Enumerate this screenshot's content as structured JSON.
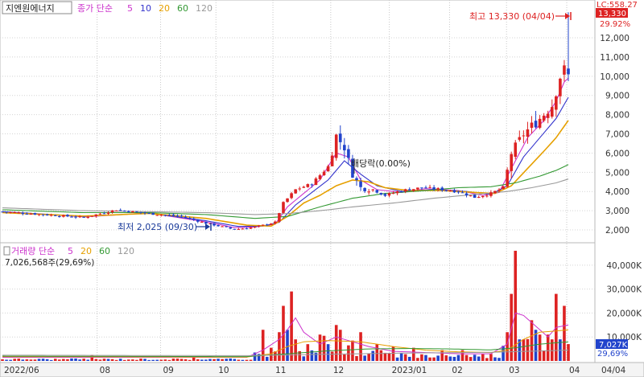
{
  "stock_name": "지엔원에너지",
  "price_legend": {
    "label": "종가 단순",
    "periods": [
      {
        "text": "5",
        "color": "#cc33cc"
      },
      {
        "text": "10",
        "color": "#3333cc"
      },
      {
        "text": "20",
        "color": "#e6a000"
      },
      {
        "text": "60",
        "color": "#339933"
      },
      {
        "text": "120",
        "color": "#999999"
      }
    ]
  },
  "volume_legend": {
    "label": "거래량 단순",
    "periods": [
      {
        "text": "5",
        "color": "#cc33cc"
      },
      {
        "text": "20",
        "color": "#e6a000"
      },
      {
        "text": "60",
        "color": "#339933"
      },
      {
        "text": "120",
        "color": "#999999"
      }
    ],
    "current_text": "7,026,568주(29,69%)"
  },
  "annotations": {
    "high": "최고 13,330 (04/04)",
    "low": "최저 2,025 (09/30)",
    "ex_right": "배당락(0.00%)",
    "top_clipped": "LC:558.27"
  },
  "right_badges": {
    "price": "13,330",
    "price_pct": "29.92%",
    "volume": "7,027K",
    "volume_pct": "29,69%"
  },
  "colors": {
    "up": "#dd2222",
    "down": "#2244cc",
    "ma5": "#cc33cc",
    "ma10": "#3333cc",
    "ma20": "#e6a000",
    "ma60": "#339933",
    "ma120": "#999999",
    "badge_red": "#dd2222",
    "badge_blue": "#2244cc"
  },
  "chart_data": {
    "type": "candlestick",
    "x_ticks": [
      "2022/06",
      "08",
      "09",
      "10",
      "11",
      "12",
      "2023/01",
      "02",
      "03",
      "04",
      "04/04"
    ],
    "price_axis": {
      "ylim": [
        1500,
        13800
      ],
      "ticks": [
        2000,
        3000,
        4000,
        5000,
        6000,
        7000,
        8000,
        9000,
        10000,
        11000,
        12000
      ],
      "tick_labels": [
        "2,000",
        "3,000",
        "4,000",
        "5,000",
        "6,000",
        "7,000",
        "8,000",
        "9,000",
        "10,000",
        "11,000",
        "12,000"
      ]
    },
    "volume_axis": {
      "ylim": [
        0,
        48000
      ],
      "ticks": [
        10000,
        20000,
        30000,
        40000
      ],
      "tick_labels": [
        "10,000K",
        "20,000K",
        "30,000K",
        "40,000K"
      ]
    },
    "price_path": [
      [
        0,
        2950
      ],
      [
        10,
        2800
      ],
      [
        20,
        2650
      ],
      [
        28,
        3050
      ],
      [
        36,
        2850
      ],
      [
        44,
        2700
      ],
      [
        50,
        2350
      ],
      [
        57,
        2025
      ],
      [
        62,
        2150
      ],
      [
        67,
        2400
      ],
      [
        69,
        3400
      ],
      [
        72,
        4100
      ],
      [
        76,
        4400
      ],
      [
        80,
        5300
      ],
      [
        82,
        6900
      ],
      [
        84,
        6300
      ],
      [
        86,
        4900
      ],
      [
        88,
        4200
      ],
      [
        91,
        4100
      ],
      [
        94,
        3800
      ],
      [
        98,
        4050
      ],
      [
        103,
        4200
      ],
      [
        108,
        4100
      ],
      [
        112,
        4000
      ],
      [
        116,
        3700
      ],
      [
        120,
        3900
      ],
      [
        123,
        4200
      ],
      [
        125,
        6000
      ],
      [
        128,
        7000
      ],
      [
        132,
        7800
      ],
      [
        135,
        8500
      ],
      [
        137,
        10000
      ],
      [
        138,
        10300
      ],
      [
        139,
        10000
      ]
    ],
    "ma_series": [
      {
        "period": "5",
        "color": "#cc33cc",
        "points": [
          [
            0,
            2950
          ],
          [
            20,
            2680
          ],
          [
            36,
            2880
          ],
          [
            50,
            2420
          ],
          [
            57,
            2120
          ],
          [
            62,
            2150
          ],
          [
            67,
            2300
          ],
          [
            70,
            3200
          ],
          [
            74,
            3900
          ],
          [
            78,
            4600
          ],
          [
            82,
            6000
          ],
          [
            85,
            5800
          ],
          [
            88,
            4600
          ],
          [
            92,
            4100
          ],
          [
            98,
            3950
          ],
          [
            104,
            4150
          ],
          [
            112,
            4050
          ],
          [
            118,
            3800
          ],
          [
            122,
            3950
          ],
          [
            125,
            5200
          ],
          [
            129,
            6800
          ],
          [
            133,
            7700
          ],
          [
            136,
            8700
          ],
          [
            138,
            9700
          ],
          [
            139,
            9900
          ]
        ]
      },
      {
        "period": "10",
        "color": "#3333cc",
        "points": [
          [
            0,
            2950
          ],
          [
            20,
            2700
          ],
          [
            36,
            2880
          ],
          [
            50,
            2480
          ],
          [
            58,
            2180
          ],
          [
            64,
            2200
          ],
          [
            68,
            2400
          ],
          [
            72,
            3300
          ],
          [
            76,
            3950
          ],
          [
            80,
            4600
          ],
          [
            84,
            5600
          ],
          [
            88,
            4900
          ],
          [
            92,
            4300
          ],
          [
            98,
            4000
          ],
          [
            106,
            4100
          ],
          [
            114,
            4000
          ],
          [
            120,
            3850
          ],
          [
            124,
            4300
          ],
          [
            128,
            5800
          ],
          [
            132,
            6800
          ],
          [
            136,
            7800
          ],
          [
            139,
            8900
          ]
        ]
      },
      {
        "period": "20",
        "color": "#e6a000",
        "points": [
          [
            0,
            2900
          ],
          [
            20,
            2720
          ],
          [
            36,
            2860
          ],
          [
            50,
            2600
          ],
          [
            60,
            2250
          ],
          [
            66,
            2200
          ],
          [
            70,
            2700
          ],
          [
            74,
            3400
          ],
          [
            78,
            3800
          ],
          [
            82,
            4300
          ],
          [
            86,
            4600
          ],
          [
            90,
            4500
          ],
          [
            94,
            4200
          ],
          [
            100,
            4050
          ],
          [
            108,
            4050
          ],
          [
            116,
            3950
          ],
          [
            121,
            3900
          ],
          [
            125,
            4300
          ],
          [
            129,
            5200
          ],
          [
            133,
            6100
          ],
          [
            136,
            6800
          ],
          [
            139,
            7700
          ]
        ]
      },
      {
        "period": "60",
        "color": "#339933",
        "points": [
          [
            0,
            3050
          ],
          [
            20,
            2900
          ],
          [
            36,
            2900
          ],
          [
            50,
            2800
          ],
          [
            62,
            2600
          ],
          [
            70,
            2700
          ],
          [
            78,
            3200
          ],
          [
            86,
            3650
          ],
          [
            94,
            3900
          ],
          [
            104,
            4050
          ],
          [
            112,
            4200
          ],
          [
            120,
            4250
          ],
          [
            126,
            4450
          ],
          [
            132,
            4800
          ],
          [
            136,
            5100
          ],
          [
            139,
            5400
          ]
        ]
      },
      {
        "period": "120",
        "color": "#999999",
        "points": [
          [
            0,
            3150
          ],
          [
            20,
            3000
          ],
          [
            36,
            2950
          ],
          [
            50,
            2900
          ],
          [
            62,
            2800
          ],
          [
            70,
            2850
          ],
          [
            78,
            3000
          ],
          [
            86,
            3200
          ],
          [
            96,
            3400
          ],
          [
            106,
            3650
          ],
          [
            116,
            3850
          ],
          [
            124,
            4000
          ],
          [
            130,
            4200
          ],
          [
            136,
            4450
          ],
          [
            139,
            4650
          ]
        ]
      }
    ],
    "volume_spikes": [
      [
        22,
        2500,
        "up"
      ],
      [
        47,
        1800,
        "up"
      ],
      [
        64,
        13000,
        "up"
      ],
      [
        66,
        5500,
        "up"
      ],
      [
        68,
        12000,
        "up"
      ],
      [
        69,
        23000,
        "up"
      ],
      [
        70,
        13000,
        "down"
      ],
      [
        71,
        29000,
        "up"
      ],
      [
        72,
        9000,
        "up"
      ],
      [
        75,
        7000,
        "up"
      ],
      [
        78,
        11000,
        "up"
      ],
      [
        79,
        10500,
        "up"
      ],
      [
        80,
        7000,
        "down"
      ],
      [
        82,
        15000,
        "up"
      ],
      [
        83,
        13000,
        "up"
      ],
      [
        85,
        6500,
        "up"
      ],
      [
        86,
        8500,
        "up"
      ],
      [
        88,
        12000,
        "up"
      ],
      [
        92,
        7000,
        "up"
      ],
      [
        96,
        6000,
        "up"
      ],
      [
        101,
        5500,
        "up"
      ],
      [
        108,
        4500,
        "up"
      ],
      [
        113,
        4500,
        "up"
      ],
      [
        124,
        12000,
        "up"
      ],
      [
        125,
        28000,
        "up"
      ],
      [
        126,
        46000,
        "up"
      ],
      [
        127,
        9000,
        "down"
      ],
      [
        128,
        9000,
        "up"
      ],
      [
        130,
        17000,
        "up"
      ],
      [
        131,
        13000,
        "down"
      ],
      [
        132,
        11000,
        "up"
      ],
      [
        134,
        11000,
        "up"
      ],
      [
        135,
        9000,
        "up"
      ],
      [
        136,
        28000,
        "up"
      ],
      [
        137,
        9000,
        "down"
      ],
      [
        138,
        23000,
        "up"
      ],
      [
        139,
        7027,
        "up"
      ]
    ],
    "volume_ma": [
      {
        "period": "5",
        "color": "#cc33cc",
        "points": [
          [
            0,
            1500
          ],
          [
            60,
            1500
          ],
          [
            64,
            4500
          ],
          [
            68,
            9000
          ],
          [
            70,
            13000
          ],
          [
            72,
            18000
          ],
          [
            74,
            12000
          ],
          [
            78,
            7000
          ],
          [
            82,
            10000
          ],
          [
            86,
            8000
          ],
          [
            90,
            6000
          ],
          [
            96,
            4000
          ],
          [
            104,
            3500
          ],
          [
            112,
            3000
          ],
          [
            120,
            3000
          ],
          [
            124,
            7000
          ],
          [
            126,
            20000
          ],
          [
            128,
            19000
          ],
          [
            130,
            16000
          ],
          [
            132,
            13000
          ],
          [
            134,
            10000
          ],
          [
            136,
            14000
          ],
          [
            139,
            15000
          ]
        ]
      },
      {
        "period": "20",
        "color": "#e6a000",
        "points": [
          [
            0,
            1800
          ],
          [
            60,
            1600
          ],
          [
            66,
            3000
          ],
          [
            70,
            6000
          ],
          [
            74,
            8000
          ],
          [
            80,
            8500
          ],
          [
            88,
            8000
          ],
          [
            96,
            6000
          ],
          [
            104,
            4500
          ],
          [
            112,
            3800
          ],
          [
            120,
            3500
          ],
          [
            124,
            4500
          ],
          [
            128,
            9000
          ],
          [
            132,
            12000
          ],
          [
            136,
            12500
          ],
          [
            139,
            13000
          ]
        ]
      },
      {
        "period": "60",
        "color": "#339933",
        "points": [
          [
            0,
            2000
          ],
          [
            60,
            1800
          ],
          [
            70,
            3000
          ],
          [
            80,
            4200
          ],
          [
            90,
            5000
          ],
          [
            100,
            5200
          ],
          [
            110,
            5000
          ],
          [
            120,
            4600
          ],
          [
            126,
            5500
          ],
          [
            132,
            7000
          ],
          [
            139,
            8000
          ]
        ]
      },
      {
        "period": "120",
        "color": "#999999",
        "points": [
          [
            0,
            2400
          ],
          [
            60,
            2200
          ],
          [
            80,
            2800
          ],
          [
            100,
            3300
          ],
          [
            120,
            3600
          ],
          [
            139,
            4500
          ]
        ]
      }
    ]
  }
}
